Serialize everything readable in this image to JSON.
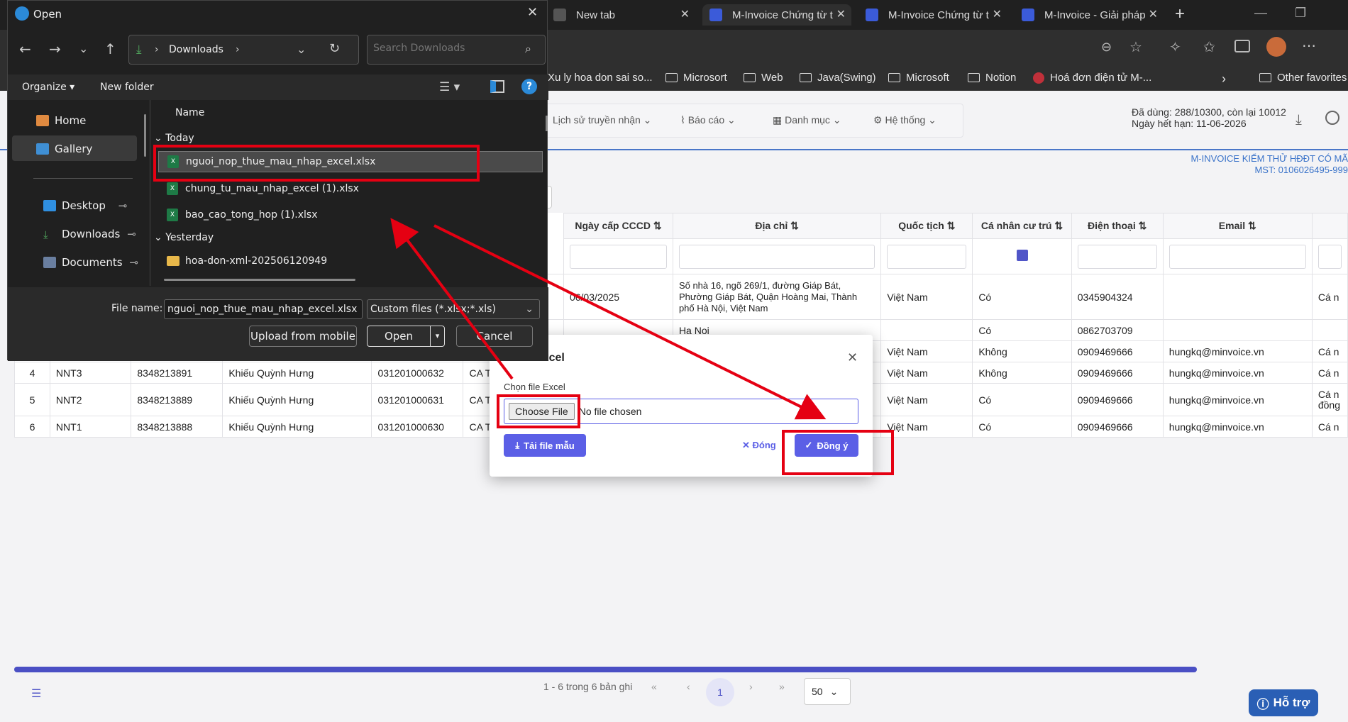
{
  "browser": {
    "tabs": [
      {
        "label": "New tab"
      },
      {
        "label": "M-Invoice Chứng từ t"
      },
      {
        "label": "M-Invoice Chứng từ t"
      },
      {
        "label": "M-Invoice - Giải pháp"
      }
    ],
    "favorites": [
      "Xu ly hoa don sai so...",
      "Microsort",
      "Web",
      "Java(Swing)",
      "Microsoft",
      "Notion",
      "Hoá đơn điện tử M-...",
      "Other favorites"
    ]
  },
  "app": {
    "nav": [
      "Lịch sử truyền nhận",
      "Báo cáo",
      "Danh mục",
      "Hệ thống"
    ],
    "usage_line1": "Đã dùng: 288/10300, còn lại 10012",
    "usage_line2": "Ngày hết hạn: 11-06-2026",
    "company_line1": "M-INVOICE KIỂM THỬ HĐĐT CÓ MÃ",
    "company_line2": "MST: 0106026495-999",
    "columns": [
      "Ngày cấp CCCD",
      "Địa chỉ",
      "Quốc tịch",
      "Cá nhân cư trú",
      "Điện thoại",
      "Email"
    ],
    "rows": [
      {
        "no": "",
        "code": "",
        "mst": "",
        "name": "",
        "cccd": "",
        "place": "",
        "date": "06/03/2025",
        "addr": "Số nhà 16, ngõ 269/1, đường Giáp Bát, Phường Giáp Bát, Quận Hoàng Mai, Thành phố Hà Nội, Việt Nam",
        "nat": "Việt Nam",
        "res": "Có",
        "phone": "0345904324",
        "email": "",
        "extra": "Cá n"
      },
      {
        "no": "",
        "code": "",
        "mst": "",
        "name": "",
        "cccd": "",
        "place": "",
        "date": "",
        "addr": "Ha Noi",
        "nat": "",
        "res": "Có",
        "phone": "0862703709",
        "email": "",
        "extra": ""
      },
      {
        "no": "",
        "code": "",
        "mst": "",
        "name": "",
        "cccd": "",
        "place": "",
        "date": "",
        "addr": "",
        "nat": "Việt Nam",
        "res": "Không",
        "phone": "0909469666",
        "email": "hungkq@minvoice.vn",
        "extra": "Cá n"
      },
      {
        "no": "4",
        "code": "NNT3",
        "mst": "8348213891",
        "name": "Khiếu Quỳnh Hưng",
        "cccd": "031201000632",
        "place": "CA Thái B",
        "date": "",
        "addr": "",
        "nat": "Việt Nam",
        "res": "Không",
        "phone": "0909469666",
        "email": "hungkq@minvoice.vn",
        "extra": "Cá n"
      },
      {
        "no": "5",
        "code": "NNT2",
        "mst": "8348213889",
        "name": "Khiếu Quỳnh Hưng",
        "cccd": "031201000631",
        "place": "CA Thái B",
        "date": "",
        "addr": "",
        "nat": "Việt Nam",
        "res": "Có",
        "phone": "0909469666",
        "email": "hungkq@minvoice.vn",
        "extra": "Cá n đồng"
      },
      {
        "no": "6",
        "code": "NNT1",
        "mst": "8348213888",
        "name": "Khiếu Quỳnh Hưng",
        "cccd": "031201000630",
        "place": "CA Thái B",
        "date": "",
        "addr": "",
        "nat": "Việt Nam",
        "res": "Có",
        "phone": "0909469666",
        "email": "hungkq@minvoice.vn",
        "extra": "Cá n"
      }
    ],
    "pager_text": "1 - 6 trong 6 bản ghi",
    "page_current": "1",
    "page_size": "50",
    "support": "Hỗ trợ"
  },
  "modal": {
    "title": "Excel",
    "field_label": "Chọn file Excel",
    "choose_file": "Choose File",
    "no_file": "No file chosen",
    "template_btn": "Tải file mẫu",
    "close_btn": "Đóng",
    "ok_btn": "Đồng ý"
  },
  "dialog": {
    "title": "Open",
    "location": "Downloads",
    "search_placeholder": "Search Downloads",
    "organize": "Organize",
    "new_folder": "New folder",
    "col_name": "Name",
    "group_today": "Today",
    "group_yesterday": "Yesterday",
    "files_today": [
      "nguoi_nop_thue_mau_nhap_excel.xlsx",
      "chung_tu_mau_nhap_excel (1).xlsx",
      "bao_cao_tong_hop (1).xlsx"
    ],
    "folders_yesterday": [
      "hoa-don-xml-202506120949"
    ],
    "sidebar": [
      "Home",
      "Gallery",
      "Desktop",
      "Downloads",
      "Documents"
    ],
    "filename_label": "File name:",
    "filename_value": "nguoi_nop_thue_mau_nhap_excel.xlsx",
    "filetype": "Custom files (*.xlsx;*.xls)",
    "upload_mobile": "Upload from mobile",
    "open": "Open",
    "cancel": "Cancel"
  },
  "colors": {
    "accent": "#5b5fe6",
    "annotation": "#e50012"
  }
}
